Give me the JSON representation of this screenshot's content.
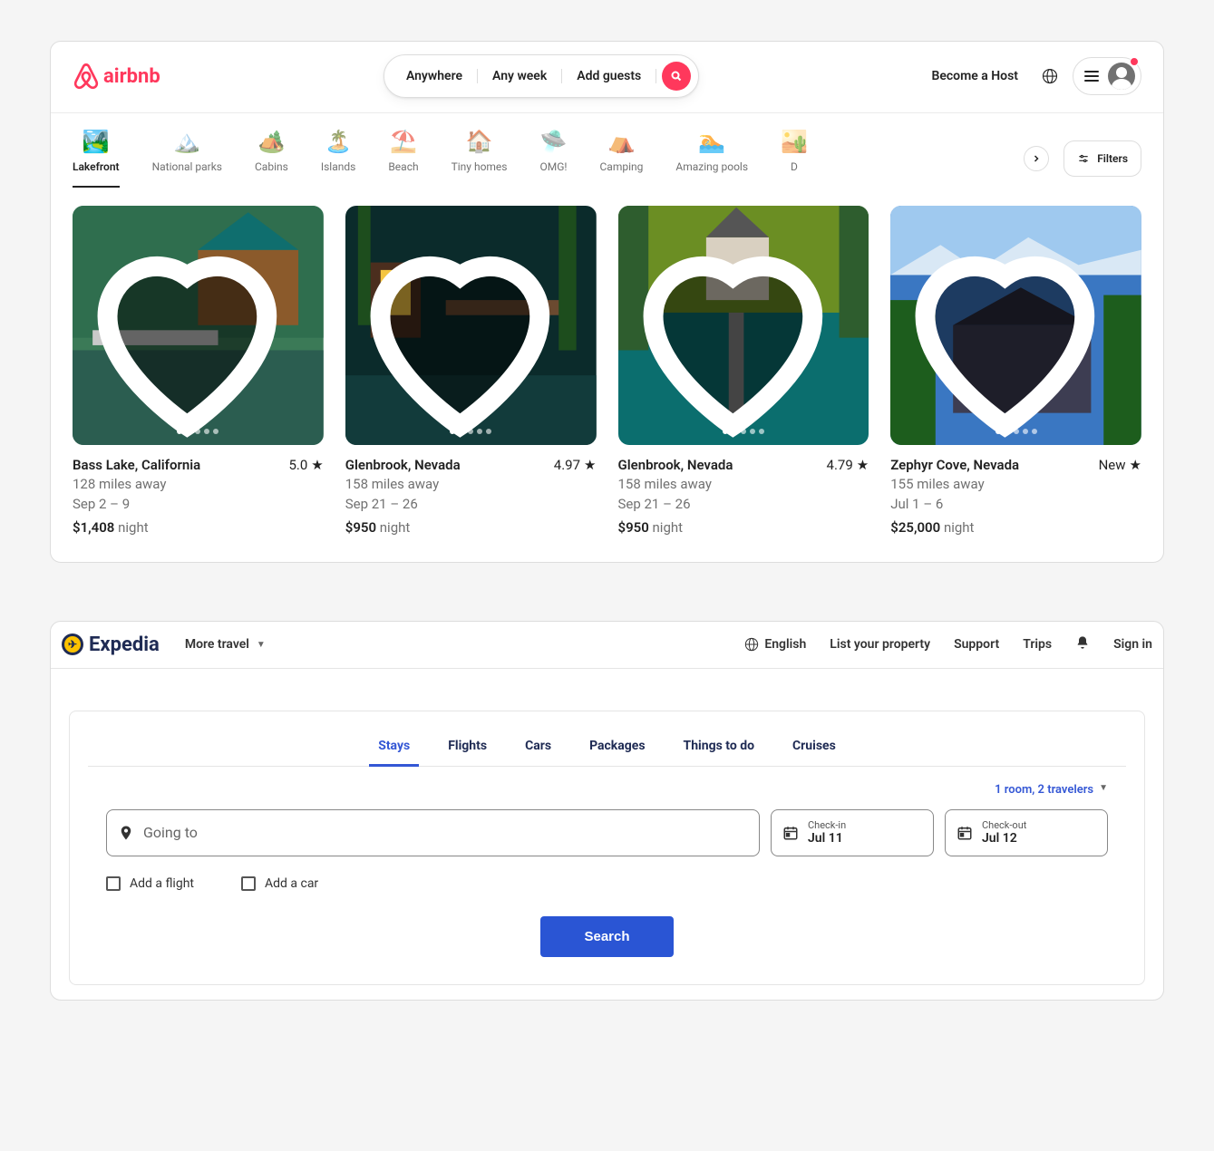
{
  "airbnb": {
    "logo_text": "airbnb",
    "search": {
      "where": "Anywhere",
      "when": "Any week",
      "who": "Add guests"
    },
    "header": {
      "host": "Become a Host"
    },
    "categories": [
      {
        "label": "Lakefront",
        "active": true
      },
      {
        "label": "National parks"
      },
      {
        "label": "Cabins"
      },
      {
        "label": "Islands"
      },
      {
        "label": "Beach"
      },
      {
        "label": "Tiny homes"
      },
      {
        "label": "OMG!"
      },
      {
        "label": "Camping"
      },
      {
        "label": "Amazing pools"
      },
      {
        "label": "D"
      }
    ],
    "filters_label": "Filters",
    "listings": [
      {
        "location": "Bass Lake, California",
        "rating": "5.0",
        "distance": "128 miles away",
        "dates": "Sep 2 – 9",
        "price": "$1,408",
        "per": "night"
      },
      {
        "location": "Glenbrook, Nevada",
        "rating": "4.97",
        "distance": "158 miles away",
        "dates": "Sep 21 – 26",
        "price": "$950",
        "per": "night"
      },
      {
        "location": "Glenbrook, Nevada",
        "rating": "4.79",
        "distance": "158 miles away",
        "dates": "Sep 21 – 26",
        "price": "$950",
        "per": "night"
      },
      {
        "location": "Zephyr Cove, Nevada",
        "rating": "New",
        "distance": "155 miles away",
        "dates": "Jul 1 – 6",
        "price": "$25,000",
        "per": "night"
      }
    ]
  },
  "expedia": {
    "logo_text": "Expedia",
    "more_travel": "More travel",
    "nav": {
      "language": "English",
      "list_property": "List your property",
      "support": "Support",
      "trips": "Trips",
      "signin": "Sign in"
    },
    "tabs": [
      "Stays",
      "Flights",
      "Cars",
      "Packages",
      "Things to do",
      "Cruises"
    ],
    "active_tab": "Stays",
    "travelers": "1 room, 2 travelers",
    "going_to_placeholder": "Going to",
    "checkin_label": "Check-in",
    "checkin_value": "Jul 11",
    "checkout_label": "Check-out",
    "checkout_value": "Jul 12",
    "add_flight": "Add a flight",
    "add_car": "Add a car",
    "search_button": "Search"
  }
}
